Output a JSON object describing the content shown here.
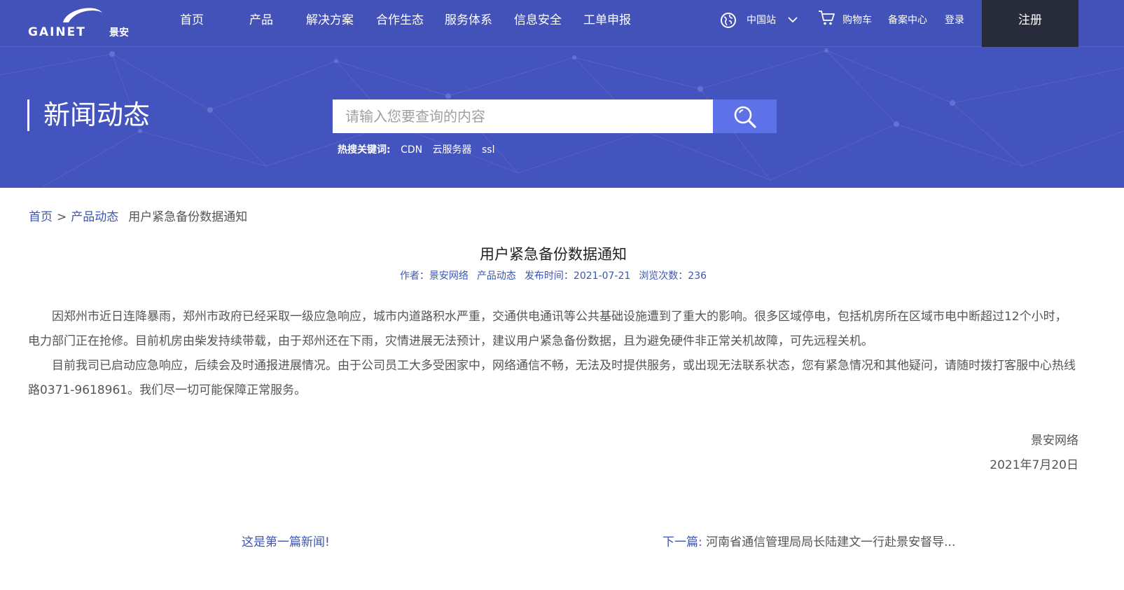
{
  "header": {
    "logo_text": "GAINET",
    "logo_cn": "景安",
    "nav": [
      "首页",
      "产品",
      "解决方案",
      "合作生态",
      "服务体系",
      "信息安全",
      "工单申报"
    ],
    "region": "中国站",
    "cart": "购物车",
    "beian": "备案中心",
    "login": "登录",
    "register": "注册",
    "icons": [
      "globe-icon",
      "chevron-down-icon",
      "cart-icon"
    ]
  },
  "banner": {
    "title": "新闻动态",
    "search_placeholder": "请输入您要查询的内容",
    "hot_label": "热搜关键词:",
    "hot_keywords": [
      "CDN",
      "云服务器",
      "ssl"
    ],
    "icons": [
      "search-icon"
    ]
  },
  "breadcrumb": {
    "home": "首页",
    "sep": ">",
    "category": "产品动态",
    "current": "用户紧急备份数据通知"
  },
  "article": {
    "title": "用户紧急备份数据通知",
    "author": "作者：景安网络",
    "category": "产品动态",
    "date": "发布时间：2021-07-21",
    "views": "浏览次数：236",
    "paragraphs": [
      "因郑州市近日连降暴雨，郑州市政府已经采取一级应急响应，城市内道路积水严重，交通供电通讯等公共基础设施遭到了重大的影响。很多区域停电，包括机房所在区域市电中断超过12个小时，电力部门正在抢修。目前机房由柴发持续带载，由于郑州还在下雨，灾情进展无法预计，建议用户紧急备份数据，且为避免硬件非正常关机故障，可先远程关机。",
      "目前我司已启动应急响应，后续会及时通报进展情况。由于公司员工大多受困家中，网络通信不畅，无法及时提供服务，或出现无法联系状态，您有紧急情况和其他疑问，请随时拨打客服中心热线路0371-9618961。我们尽一切可能保障正常服务。"
    ],
    "sign_org": "景安网络",
    "sign_date": "2021年7月20日"
  },
  "pager": {
    "prev": "这是第一篇新闻!",
    "next_label": "下一篇:",
    "next_title": "河南省通信管理局局长陆建文一行赴景安督导..."
  },
  "colors": {
    "nav_bg": "#4252b9",
    "banner_bg": "#4454be",
    "register_bg": "#282c3a",
    "search_btn": "#5d72e8",
    "link": "#3d56b0"
  }
}
